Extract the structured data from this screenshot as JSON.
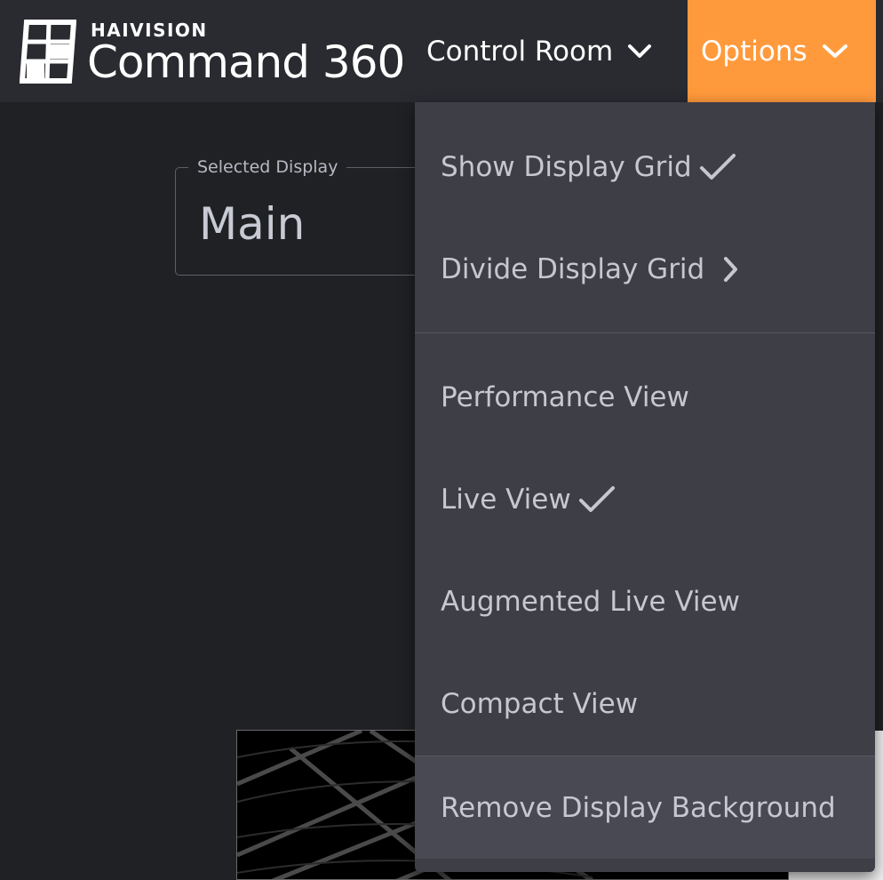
{
  "header": {
    "brand_company": "HAIVISION",
    "brand_product": "Command 360",
    "nav_control_room": "Control Room",
    "nav_options": "Options",
    "colors": {
      "topbar": "#2a2b31",
      "options_accent": "#ff9a3c"
    }
  },
  "selected_display": {
    "label": "Selected Display",
    "value": "Main"
  },
  "options_menu": {
    "items": [
      {
        "label": "Show Display Grid",
        "icon": "checkmark-icon",
        "checked": true
      },
      {
        "label": "Divide Display Grid",
        "icon": "chevron-right-icon",
        "checked": false
      },
      {
        "label": "Performance View",
        "checked": false
      },
      {
        "label": "Live View",
        "icon": "checkmark-icon",
        "checked": true
      },
      {
        "label": "Augmented Live View",
        "checked": false
      },
      {
        "label": "Compact View",
        "checked": false
      },
      {
        "label": "Remove Display Background",
        "checked": false
      }
    ]
  }
}
